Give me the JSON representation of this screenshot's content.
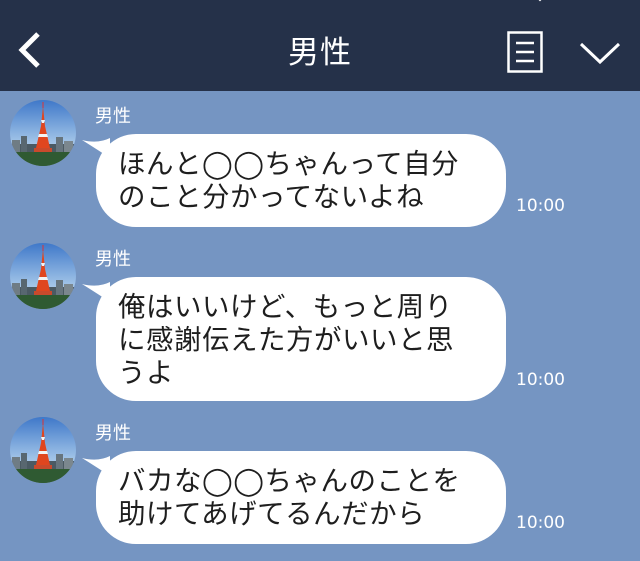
{
  "header": {
    "title": "男性",
    "back_icon": "chevron-left-icon",
    "menu_icon": "note-menu-icon",
    "dropdown_icon": "chevron-down-icon",
    "bg_color": "#253149"
  },
  "chat": {
    "bg_color": "#7595c2",
    "messages": [
      {
        "sender": "男性",
        "lines": [
          "ほんと◯◯ちゃんって自分",
          "のこと分かってないよね"
        ],
        "time": "10:00"
      },
      {
        "sender": "男性",
        "lines": [
          "俺はいいけど、もっと周り",
          "に感謝伝えた方がいいと思",
          "うよ"
        ],
        "time": "10:00"
      },
      {
        "sender": "男性",
        "lines": [
          "バカな◯◯ちゃんのことを",
          "助けてあげてるんだから"
        ],
        "time": "10:00"
      }
    ]
  }
}
